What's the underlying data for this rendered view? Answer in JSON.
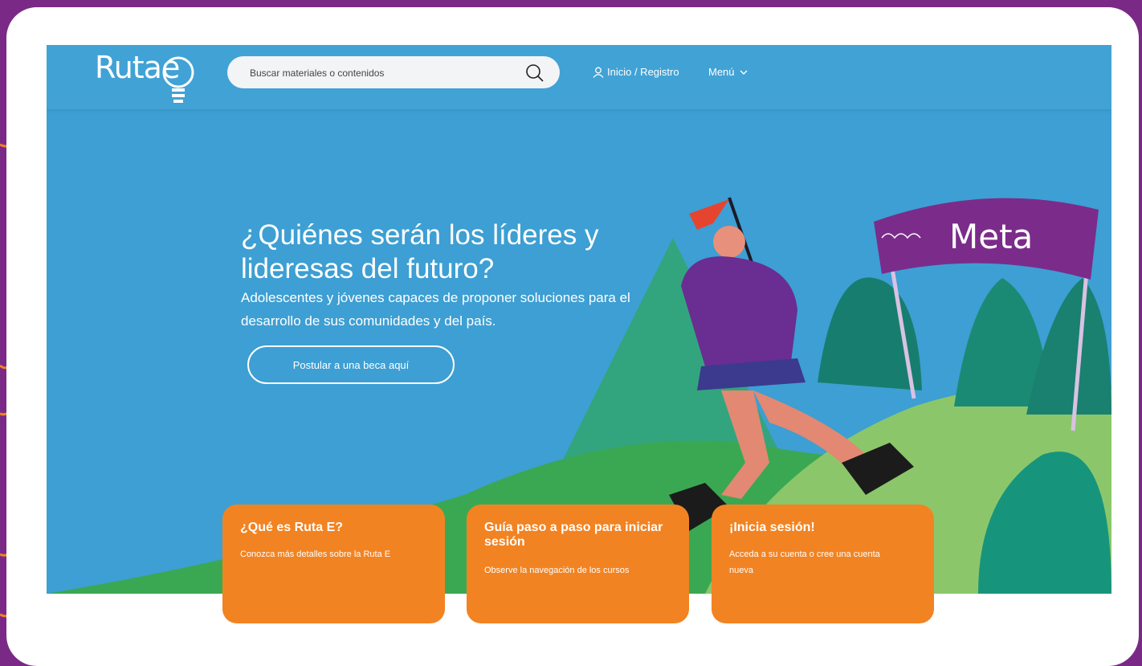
{
  "brand": {
    "logo_text": "Rutae"
  },
  "search": {
    "placeholder": "Buscar materiales o contenidos"
  },
  "nav": {
    "login_label": "Inicio / Registro",
    "menu_label": "Menú"
  },
  "hero": {
    "title": "¿Quiénes serán los líderes y lideresas del futuro?",
    "subtitle": "Adolescentes y jóvenes capaces de proponer soluciones para el desarrollo de sus comunidades y del país.",
    "cta_label": "Postular a una beca aquí"
  },
  "illustration": {
    "banner_text": "Meta"
  },
  "cards": [
    {
      "title": "¿Qué es Ruta E?",
      "text": "Conozca más detalles sobre la Ruta E"
    },
    {
      "title": "Guía paso a paso para iniciar sesión",
      "text": "Observe la navegación de los cursos"
    },
    {
      "title": "¡Inicia sesión!",
      "text": "Acceda a su cuenta o cree una cuenta nueva"
    }
  ],
  "colors": {
    "frame": "#7a2a86",
    "hero_bg": "#3d9fd3",
    "card_orange": "#f28322",
    "banner_purple": "#7b2c8a"
  }
}
